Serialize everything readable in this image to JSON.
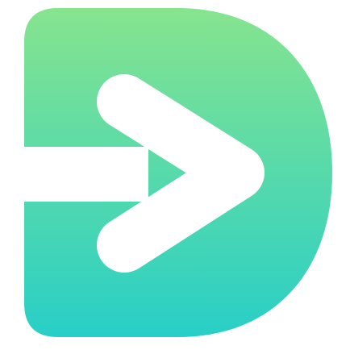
{
  "logo": {
    "icon": "d-arrow-logo-icon",
    "gradient_top": "#86E48E",
    "gradient_bottom": "#28CFC7",
    "cutout": "#FFFFFF"
  }
}
